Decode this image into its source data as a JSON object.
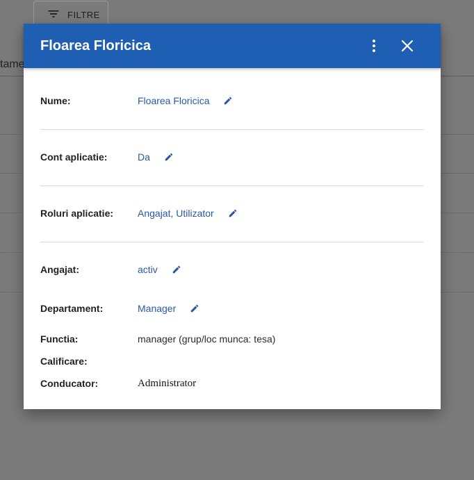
{
  "background": {
    "filter_button_label": "FILTRE",
    "column_header_partial": "tame"
  },
  "dialog": {
    "title": "Floarea Floricica",
    "header_color": "#1e5fb4",
    "fields": [
      {
        "label": "Nume:",
        "value": "Floarea Floricica",
        "editable": true
      },
      {
        "label": "Cont aplicatie:",
        "value": "Da",
        "editable": true
      },
      {
        "label": "Roluri aplicatie:",
        "value": "Angajat, Utilizator",
        "editable": true
      },
      {
        "label": "Angajat:",
        "value": "activ",
        "editable": true
      },
      {
        "label": "Departament:",
        "value": "Manager",
        "editable": true
      },
      {
        "label": "Functia:",
        "value": "manager (grup/loc munca: tesa)",
        "editable": false
      },
      {
        "label": "Calificare:",
        "value": "",
        "editable": false
      },
      {
        "label": "Conducator:",
        "value": "Administrator",
        "editable": false
      }
    ]
  }
}
